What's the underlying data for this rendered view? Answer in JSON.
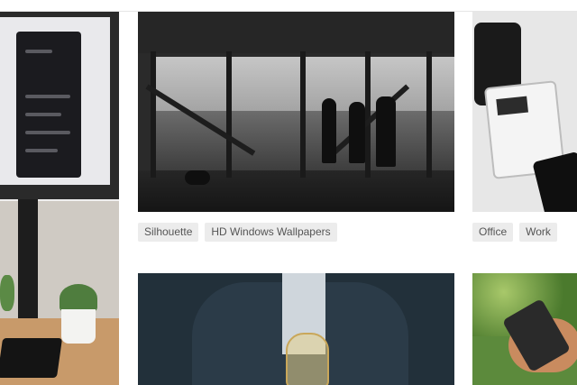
{
  "gallery": {
    "cards": [
      {
        "tags": []
      },
      {
        "tags": [
          "Silhouette",
          "HD Windows Wallpapers"
        ]
      },
      {
        "tags": [
          "Office",
          "Work"
        ]
      },
      {
        "tags": []
      },
      {
        "tags": []
      }
    ]
  }
}
